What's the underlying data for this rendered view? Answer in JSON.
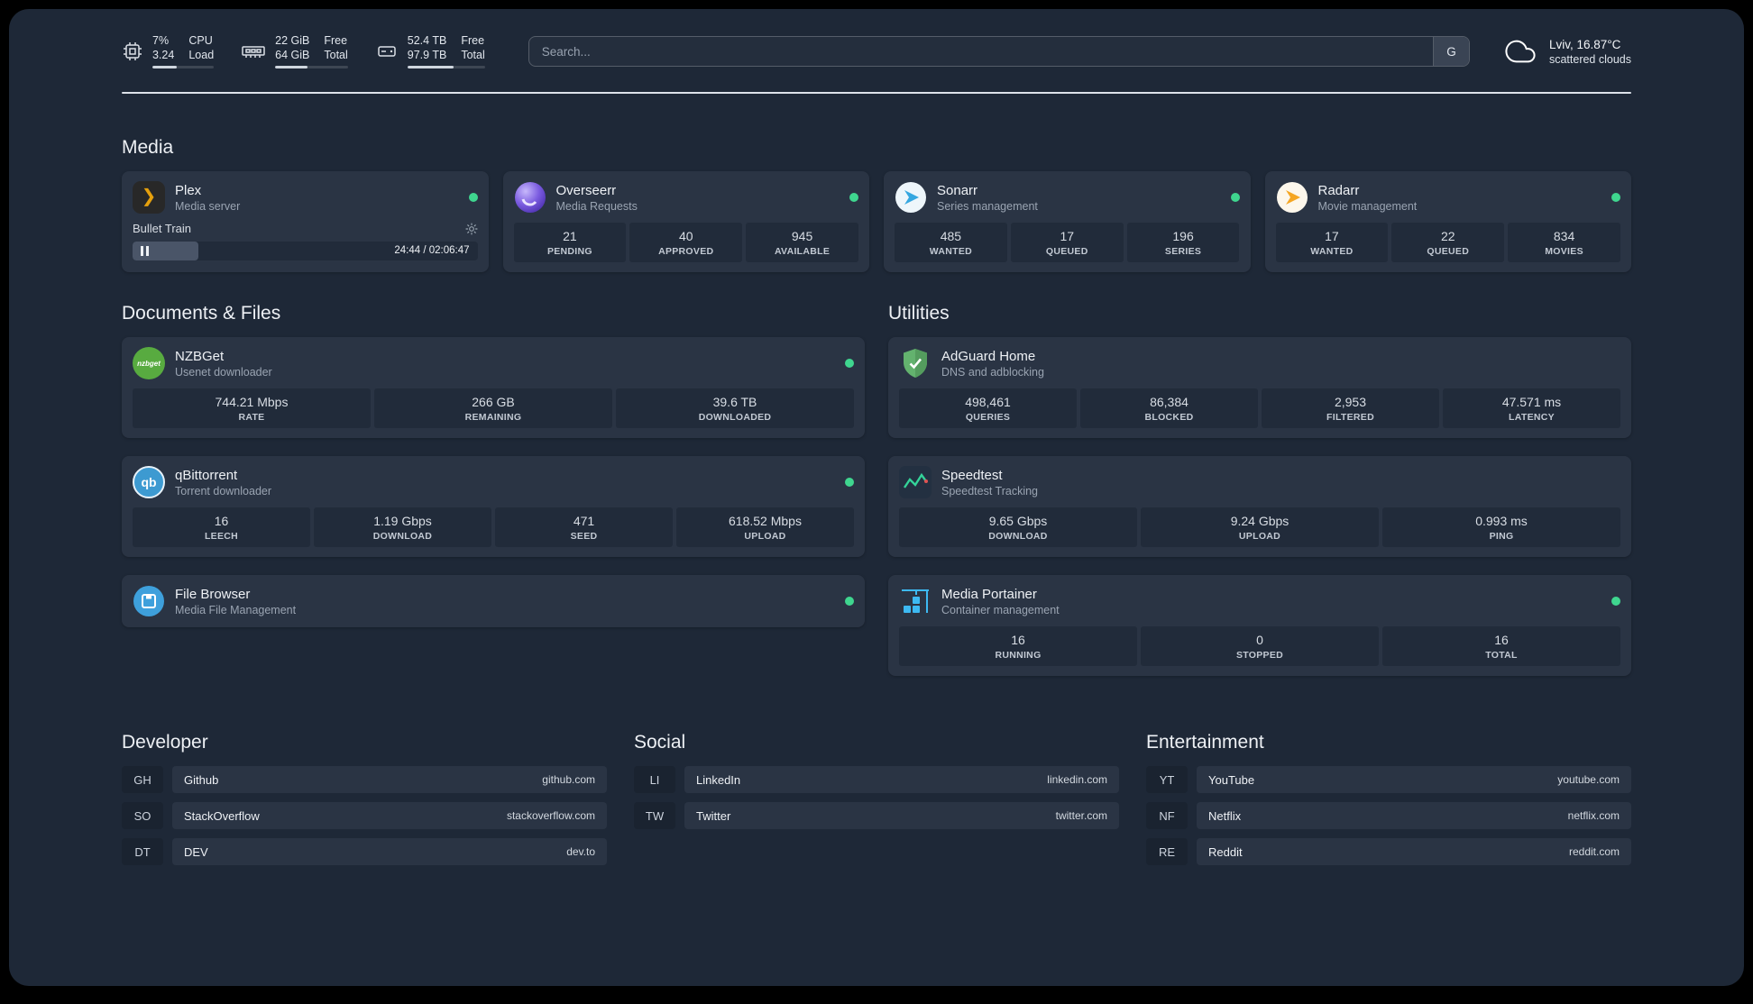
{
  "topbar": {
    "cpu": {
      "value_top": "7%",
      "value_bottom": "3.24",
      "label_top": "CPU",
      "label_bottom": "Load",
      "bar": "40%"
    },
    "memory": {
      "value_top": "22 GiB",
      "value_bottom": "64 GiB",
      "label_top": "Free",
      "label_bottom": "Total",
      "bar": "44%"
    },
    "disk": {
      "value_top": "52.4 TB",
      "value_bottom": "97.9 TB",
      "label_top": "Free",
      "label_bottom": "Total",
      "bar": "60%"
    },
    "search": {
      "placeholder": "Search...",
      "provider": "G"
    },
    "weather": {
      "location": "Lviv, 16.87°C",
      "condition": "scattered clouds"
    }
  },
  "sections": {
    "media": "Media",
    "documents": "Documents & Files",
    "utilities": "Utilities",
    "developer": "Developer",
    "social": "Social",
    "entertainment": "Entertainment"
  },
  "services": {
    "plex": {
      "title": "Plex",
      "subtitle": "Media server",
      "now_playing": "Bullet Train",
      "time": "24:44 / 02:06:47",
      "progress": "19%"
    },
    "overseerr": {
      "title": "Overseerr",
      "subtitle": "Media Requests",
      "stats": [
        {
          "value": "21",
          "label": "PENDING"
        },
        {
          "value": "40",
          "label": "APPROVED"
        },
        {
          "value": "945",
          "label": "AVAILABLE"
        }
      ]
    },
    "sonarr": {
      "title": "Sonarr",
      "subtitle": "Series management",
      "stats": [
        {
          "value": "485",
          "label": "WANTED"
        },
        {
          "value": "17",
          "label": "QUEUED"
        },
        {
          "value": "196",
          "label": "SERIES"
        }
      ]
    },
    "radarr": {
      "title": "Radarr",
      "subtitle": "Movie management",
      "stats": [
        {
          "value": "17",
          "label": "WANTED"
        },
        {
          "value": "22",
          "label": "QUEUED"
        },
        {
          "value": "834",
          "label": "MOVIES"
        }
      ]
    },
    "nzbget": {
      "title": "NZBGet",
      "subtitle": "Usenet downloader",
      "logo_text": "nzbget",
      "stats": [
        {
          "value": "744.21 Mbps",
          "label": "RATE"
        },
        {
          "value": "266 GB",
          "label": "REMAINING"
        },
        {
          "value": "39.6 TB",
          "label": "DOWNLOADED"
        }
      ]
    },
    "qbittorrent": {
      "title": "qBittorrent",
      "subtitle": "Torrent downloader",
      "logo_text": "qb",
      "stats": [
        {
          "value": "16",
          "label": "LEECH"
        },
        {
          "value": "1.19 Gbps",
          "label": "DOWNLOAD"
        },
        {
          "value": "471",
          "label": "SEED"
        },
        {
          "value": "618.52 Mbps",
          "label": "UPLOAD"
        }
      ]
    },
    "filebrowser": {
      "title": "File Browser",
      "subtitle": "Media File Management"
    },
    "adguard": {
      "title": "AdGuard Home",
      "subtitle": "DNS and adblocking",
      "stats": [
        {
          "value": "498,461",
          "label": "QUERIES"
        },
        {
          "value": "86,384",
          "label": "BLOCKED"
        },
        {
          "value": "2,953",
          "label": "FILTERED"
        },
        {
          "value": "47.571 ms",
          "label": "LATENCY"
        }
      ]
    },
    "speedtest": {
      "title": "Speedtest",
      "subtitle": "Speedtest Tracking",
      "stats": [
        {
          "value": "9.65 Gbps",
          "label": "DOWNLOAD"
        },
        {
          "value": "9.24 Gbps",
          "label": "UPLOAD"
        },
        {
          "value": "0.993 ms",
          "label": "PING"
        }
      ]
    },
    "portainer": {
      "title": "Media Portainer",
      "subtitle": "Container management",
      "stats": [
        {
          "value": "16",
          "label": "RUNNING"
        },
        {
          "value": "0",
          "label": "STOPPED"
        },
        {
          "value": "16",
          "label": "TOTAL"
        }
      ]
    },
    "plex_logo": "❯"
  },
  "bookmarks": {
    "developer": [
      {
        "abbr": "GH",
        "name": "Github",
        "url": "github.com"
      },
      {
        "abbr": "SO",
        "name": "StackOverflow",
        "url": "stackoverflow.com"
      },
      {
        "abbr": "DT",
        "name": "DEV",
        "url": "dev.to"
      }
    ],
    "social": [
      {
        "abbr": "LI",
        "name": "LinkedIn",
        "url": "linkedin.com"
      },
      {
        "abbr": "TW",
        "name": "Twitter",
        "url": "twitter.com"
      }
    ],
    "entertainment": [
      {
        "abbr": "YT",
        "name": "YouTube",
        "url": "youtube.com"
      },
      {
        "abbr": "NF",
        "name": "Netflix",
        "url": "netflix.com"
      },
      {
        "abbr": "RE",
        "name": "Reddit",
        "url": "reddit.com"
      }
    ]
  }
}
